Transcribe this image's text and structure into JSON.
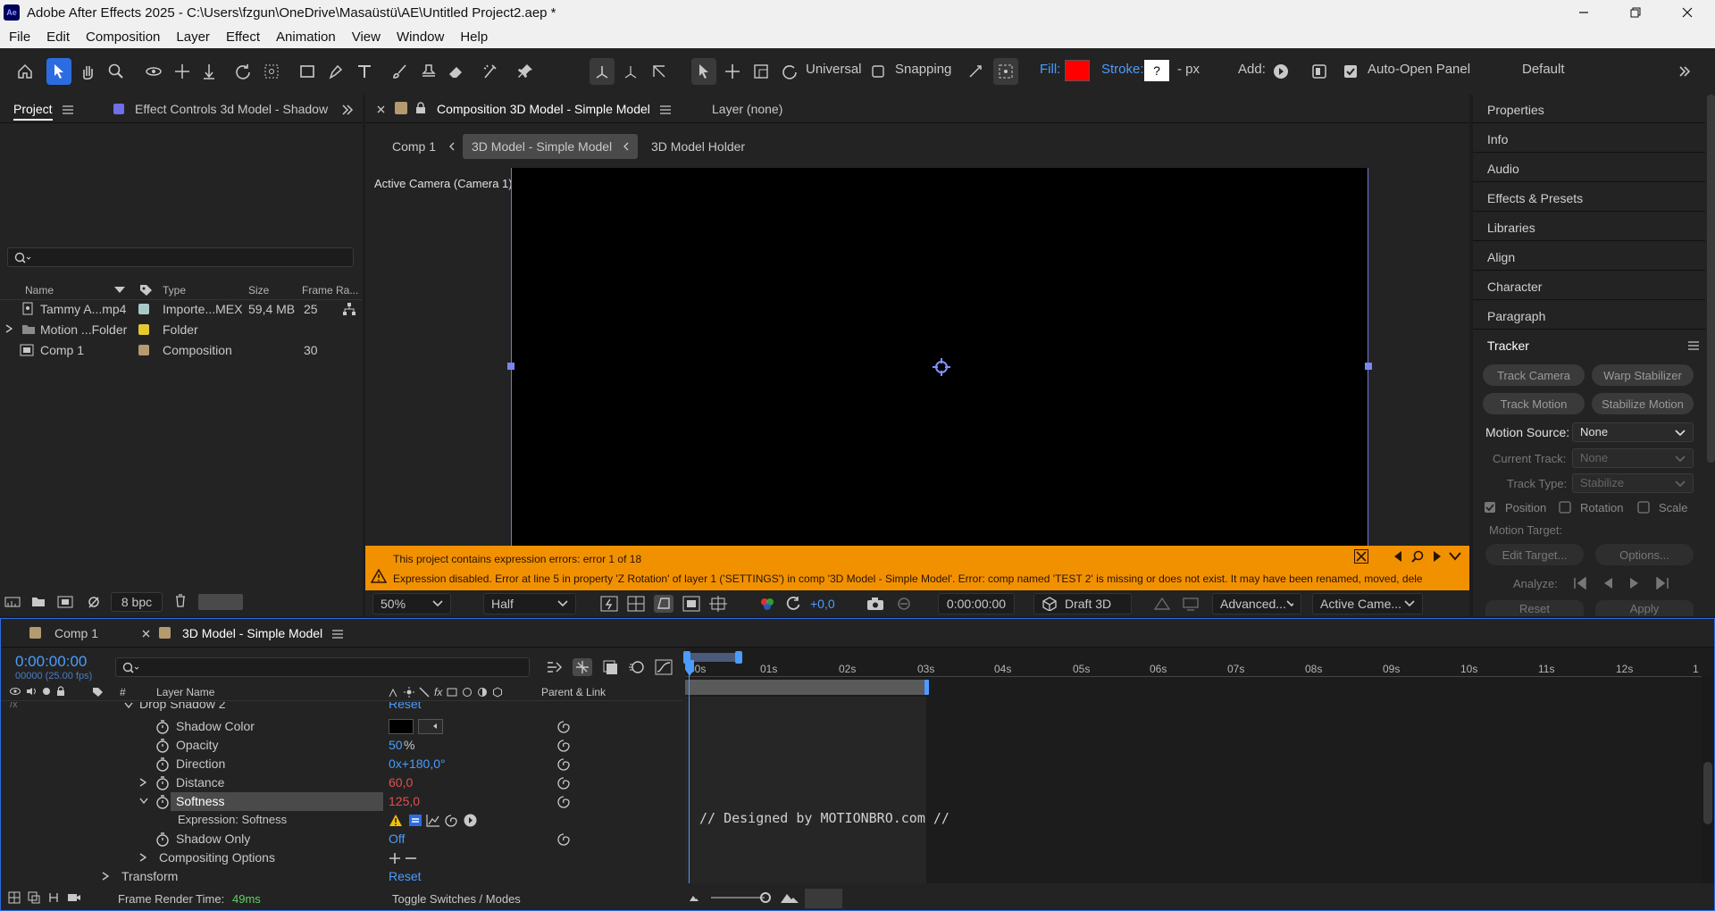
{
  "window": {
    "logo": "Ae",
    "title": "Adobe After Effects 2025 - C:\\Users\\fzgun\\OneDrive\\Masaüstü\\AE\\Untitled Project2.aep *"
  },
  "menu": [
    "File",
    "Edit",
    "Composition",
    "Layer",
    "Effect",
    "Animation",
    "View",
    "Window",
    "Help"
  ],
  "toolbar": {
    "universal": "Universal",
    "snapping": "Snapping",
    "fill": "Fill:",
    "stroke": "Stroke:",
    "stroke_value": "?",
    "stroke_unit": "- px",
    "add": "Add:",
    "auto_open": "Auto-Open Panel",
    "workspace": "Default",
    "fill_color": "#ff0000"
  },
  "project": {
    "tab_project": "Project",
    "tab_effect_controls": "Effect Controls 3d Model - Shadow",
    "columns": {
      "name": "Name",
      "type": "Type",
      "size": "Size",
      "frame_rate": "Frame Ra..."
    },
    "items": [
      {
        "name": "Tammy A...mp4",
        "type": "Importe...MEX",
        "size": "59,4 MB",
        "frame_rate": "25",
        "label_color": "#a9c9c9"
      },
      {
        "name": "Motion ...Folder",
        "type": "Folder",
        "size": "",
        "frame_rate": "",
        "label_color": "#e6c830"
      },
      {
        "name": "Comp 1",
        "type": "Composition",
        "size": "",
        "frame_rate": "30",
        "label_color": "#b59a70"
      }
    ],
    "bpc": "8 bpc"
  },
  "comp": {
    "tab": "Composition 3D Model - Simple Model",
    "layer_tab": "Layer (none)",
    "crumbs": [
      "Comp 1",
      "3D Model - Simple Model",
      "3D Model Holder"
    ],
    "camera_label": "Active Camera (Camera 1)",
    "error_line1": "This project contains expression errors: error 1 of 18",
    "error_line2": "Expression disabled. Error at line 5 in property 'Z Rotation' of layer 1 ('SETTINGS') in comp '3D Model - Simple Model'.  Error: comp named 'TEST 2' is missing or does not exist. It may have been renamed, moved, dele",
    "zoom": "50%",
    "resolution": "Half",
    "exposure": "+0,0",
    "timecode": "0:00:00:00",
    "renderer": "Draft 3D",
    "advanced": "Advanced...",
    "view": "Active Came..."
  },
  "right_panel": {
    "items": [
      "Properties",
      "Info",
      "Audio",
      "Effects & Presets",
      "Libraries",
      "Align",
      "Character",
      "Paragraph"
    ],
    "tracker": {
      "title": "Tracker",
      "track_camera": "Track Camera",
      "warp_stabilizer": "Warp Stabilizer",
      "track_motion": "Track Motion",
      "stabilize_motion": "Stabilize Motion",
      "motion_source_label": "Motion Source:",
      "motion_source": "None",
      "current_track_label": "Current Track:",
      "current_track": "None",
      "track_type_label": "Track Type:",
      "track_type": "Stabilize",
      "position": "Position",
      "rotation": "Rotation",
      "scale": "Scale",
      "motion_target": "Motion Target:",
      "edit_target": "Edit Target...",
      "options": "Options...",
      "analyze": "Analyze:",
      "reset": "Reset",
      "apply": "Apply"
    }
  },
  "timeline": {
    "tab_comp1": "Comp 1",
    "tab_main": "3D Model - Simple Model",
    "timecode": "0:00:00:00",
    "frames": "00000 (25.00 fps)",
    "col_layer_name": "Layer Name",
    "col_parent": "Parent & Link",
    "group_name": "Drop Shadow 2",
    "group_reset": "Reset",
    "props": [
      {
        "name": "Shadow Color",
        "value": ""
      },
      {
        "name": "Opacity",
        "value": "50",
        "unit": "%"
      },
      {
        "name": "Direction",
        "value": "0x+180,0°"
      },
      {
        "name": "Distance",
        "value": "60,0"
      },
      {
        "name": "Softness",
        "value": "125,0"
      },
      {
        "name": "Expression: Softness",
        "value": ""
      },
      {
        "name": "Shadow Only",
        "value": "Off"
      },
      {
        "name": "Compositing Options",
        "value": ""
      }
    ],
    "transform": "Transform",
    "transform_reset": "Reset",
    "expression_text": "// Designed by MOTIONBRO.com //",
    "ruler": [
      "00s",
      "01s",
      "02s",
      "03s",
      "04s",
      "05s",
      "06s",
      "07s",
      "08s",
      "09s",
      "10s",
      "11s",
      "12s",
      "1"
    ],
    "render_time_label": "Frame Render Time:",
    "render_time": "49ms",
    "toggle_label": "Toggle Switches / Modes"
  }
}
